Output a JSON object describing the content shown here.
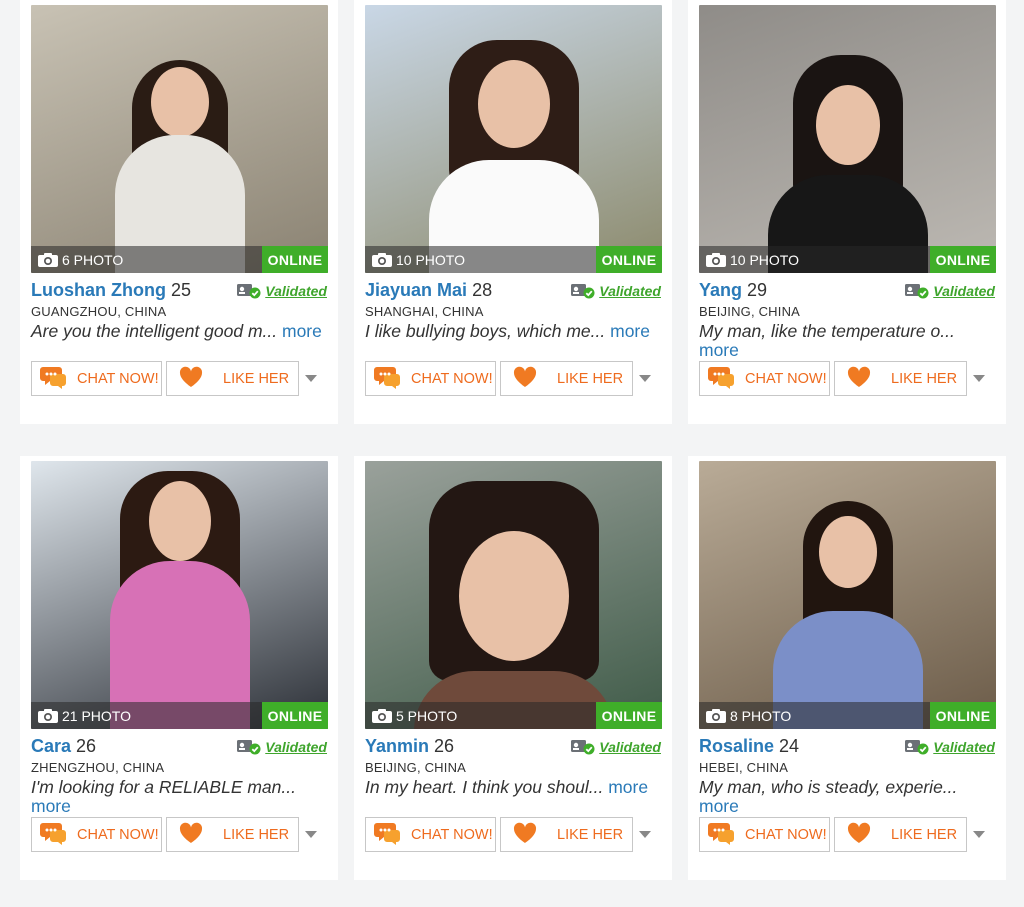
{
  "profiles": [
    {
      "photo_count": "6 PHOTO",
      "status": "ONLINE",
      "name": "Luoshan Zhong",
      "age": "25",
      "validated": "Validated",
      "location": "GUANGZHOU, CHINA",
      "bio": "Are you the intelligent good m...",
      "more": "more",
      "chat": "CHAT NOW!",
      "like": "LIKE HER",
      "bg": "#c8c2b4",
      "bg2": "#8a8272",
      "hair": "#2a1c14",
      "cloth": "#e7e5e0"
    },
    {
      "photo_count": "10 PHOTO",
      "status": "ONLINE",
      "name": "Jiayuan Mai",
      "age": "28",
      "validated": "Validated",
      "location": "SHANGHAI, CHINA",
      "bio": "I like bullying boys, which me...",
      "more": "more",
      "chat": "CHAT NOW!",
      "like": "LIKE HER",
      "bg": "#c9d7e6",
      "bg2": "#8c8a6c",
      "hair": "#2e1d16",
      "cloth": "#fafafa"
    },
    {
      "photo_count": "10 PHOTO",
      "status": "ONLINE",
      "name": "Yang",
      "age": "29",
      "validated": "Validated",
      "location": "BEIJING, CHINA",
      "bio": "My man, like the temperature o...",
      "more": "more",
      "chat": "CHAT NOW!",
      "like": "LIKE HER",
      "bg": "#8f8c88",
      "bg2": "#bdb9b3",
      "hair": "#1a1412",
      "cloth": "#171717"
    },
    {
      "photo_count": "21 PHOTO",
      "status": "ONLINE",
      "name": "Cara",
      "age": "26",
      "validated": "Validated",
      "location": "ZHENGZHOU, CHINA",
      "bio": "I'm looking for a RELIABLE man...",
      "more": "more",
      "chat": "CHAT NOW!",
      "like": "LIKE HER",
      "bg": "#dfe6ec",
      "bg2": "#2b2f36",
      "hair": "#2c1a12",
      "cloth": "#d771b6"
    },
    {
      "photo_count": "5 PHOTO",
      "status": "ONLINE",
      "name": "Yanmin",
      "age": "26",
      "validated": "Validated",
      "location": "BEIJING, CHINA",
      "bio": "In my heart. I think you shoul...",
      "more": "more",
      "chat": "CHAT NOW!",
      "like": "LIKE HER",
      "bg": "#9aa19b",
      "bg2": "#3f5b48",
      "hair": "#231713",
      "cloth": "#6f4a3b"
    },
    {
      "photo_count": "8 PHOTO",
      "status": "ONLINE",
      "name": "Rosaline",
      "age": "24",
      "validated": "Validated",
      "location": "HEBEI, CHINA",
      "bio": "My man, who is steady, experie...",
      "more": "more",
      "chat": "CHAT NOW!",
      "like": "LIKE HER",
      "bg": "#b9ab97",
      "bg2": "#6b5b48",
      "hair": "#21150f",
      "cloth": "#7b8fc8"
    }
  ]
}
